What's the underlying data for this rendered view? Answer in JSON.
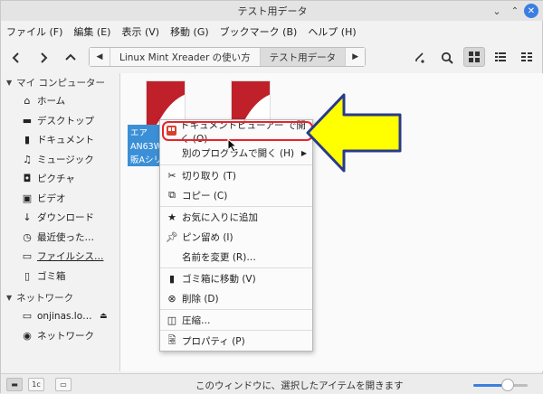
{
  "window": {
    "title": "テスト用データ"
  },
  "menubar": [
    "ファイル (F)",
    "編集 (E)",
    "表示 (V)",
    "移動 (G)",
    "ブックマーク (B)",
    "ヘルプ (H)"
  ],
  "breadcrumbs": [
    "Linux Mint Xreader の使い方",
    "テスト用データ"
  ],
  "sidebar": {
    "sections": [
      {
        "title": "マイ コンピューター",
        "items": [
          {
            "label": "ホーム",
            "icon": "home-icon"
          },
          {
            "label": "デスクトップ",
            "icon": "desktop-icon"
          },
          {
            "label": "ドキュメント",
            "icon": "document-icon"
          },
          {
            "label": "ミュージック",
            "icon": "music-icon"
          },
          {
            "label": "ピクチャ",
            "icon": "picture-icon"
          },
          {
            "label": "ビデオ",
            "icon": "video-icon"
          },
          {
            "label": "ダウンロード",
            "icon": "download-icon"
          },
          {
            "label": "最近使った…",
            "icon": "recent-icon"
          },
          {
            "label": "ファイルシス…",
            "icon": "filesystem-icon"
          },
          {
            "label": "ゴミ箱",
            "icon": "trash-icon"
          }
        ]
      },
      {
        "title": "ネットワーク",
        "items": [
          {
            "label": "onjinas.lo…",
            "icon": "nas-icon"
          },
          {
            "label": "ネットワーク",
            "icon": "network-icon"
          }
        ]
      }
    ]
  },
  "file": {
    "label": "エア\nAN63W\n販Aシリ"
  },
  "context_menu": {
    "items": [
      {
        "label": "ドキュメントビューアー で開く (O)",
        "icon": "xreader-icon"
      },
      {
        "label": "別のプログラムで開く (H)",
        "icon": ""
      },
      {
        "label": "切り取り (T)",
        "icon": "cut-icon"
      },
      {
        "label": "コピー (C)",
        "icon": "copy-icon"
      },
      {
        "label": "お気に入りに追加",
        "icon": "star-icon"
      },
      {
        "label": "ピン留め (I)",
        "icon": "pin-icon"
      },
      {
        "label": "名前を変更 (R)…",
        "icon": ""
      },
      {
        "label": "ゴミ箱に移動 (V)",
        "icon": "trash-icon"
      },
      {
        "label": "削除 (D)",
        "icon": "delete-icon"
      },
      {
        "label": "圧縮…",
        "icon": "compress-icon"
      },
      {
        "label": "プロパティ (P)",
        "icon": "properties-icon"
      }
    ]
  },
  "status": {
    "text": "このウィンドウに、選択したアイテムを開きます",
    "zoom_fraction": 0.6
  },
  "colors": {
    "accent": "#3a7fe0",
    "highlight": "#e8232a",
    "callout_fill": "#ffff00",
    "callout_stroke": "#2a3a8a",
    "selection": "#3b8fd6"
  }
}
